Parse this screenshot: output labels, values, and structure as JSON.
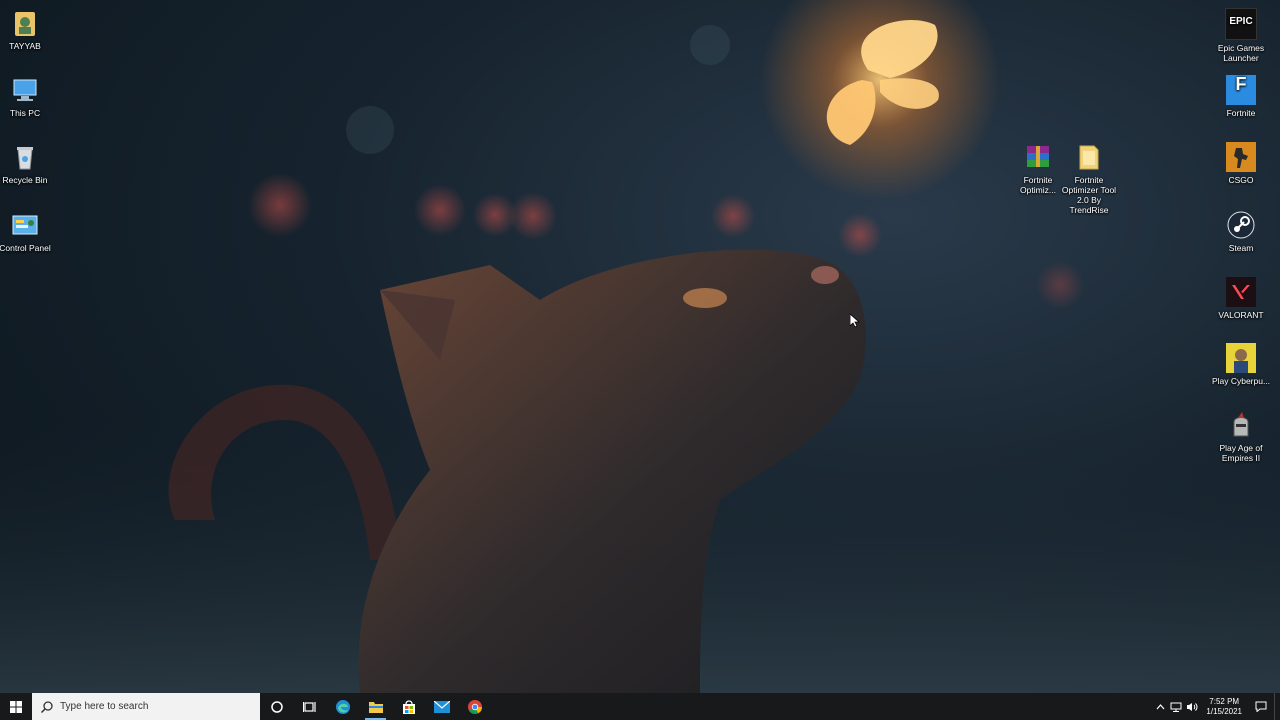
{
  "desktop": {
    "left_icons": [
      {
        "label": "TAYYAB",
        "icon": "user-folder-icon"
      },
      {
        "label": "This PC",
        "icon": "computer-icon"
      },
      {
        "label": "Recycle Bin",
        "icon": "recycle-bin-icon"
      },
      {
        "label": "Control Panel",
        "icon": "control-panel-icon"
      }
    ],
    "middle_icons": [
      {
        "label": "Fortnite Optimiz...",
        "icon": "winrar-archive-icon"
      },
      {
        "label": "Fortnite Optimizer Tool 2.0 By TrendRise",
        "icon": "folder-icon"
      }
    ],
    "right_icons": [
      {
        "label": "Epic Games Launcher",
        "icon": "epic-games-icon",
        "glyph": "EPIC"
      },
      {
        "label": "Fortnite",
        "icon": "fortnite-icon",
        "glyph": "F"
      },
      {
        "label": "CSGO",
        "icon": "csgo-icon"
      },
      {
        "label": "Steam",
        "icon": "steam-icon"
      },
      {
        "label": "VALORANT",
        "icon": "valorant-icon"
      },
      {
        "label": "Play Cyberpu...",
        "icon": "cyberpunk-icon"
      },
      {
        "label": "Play Age of Empires II",
        "icon": "age-of-empires-icon"
      }
    ]
  },
  "taskbar": {
    "search_placeholder": "Type here to search",
    "apps": [
      "cortana-icon",
      "task-view-icon",
      "edge-icon",
      "file-explorer-icon",
      "store-icon",
      "mail-icon",
      "chrome-icon"
    ],
    "clock_time": "7:52 PM",
    "clock_date": "1/15/2021"
  },
  "colors": {
    "taskbar_bg": "#17191b",
    "search_bg": "#f2f2f2",
    "accent": "#76b9ed"
  }
}
